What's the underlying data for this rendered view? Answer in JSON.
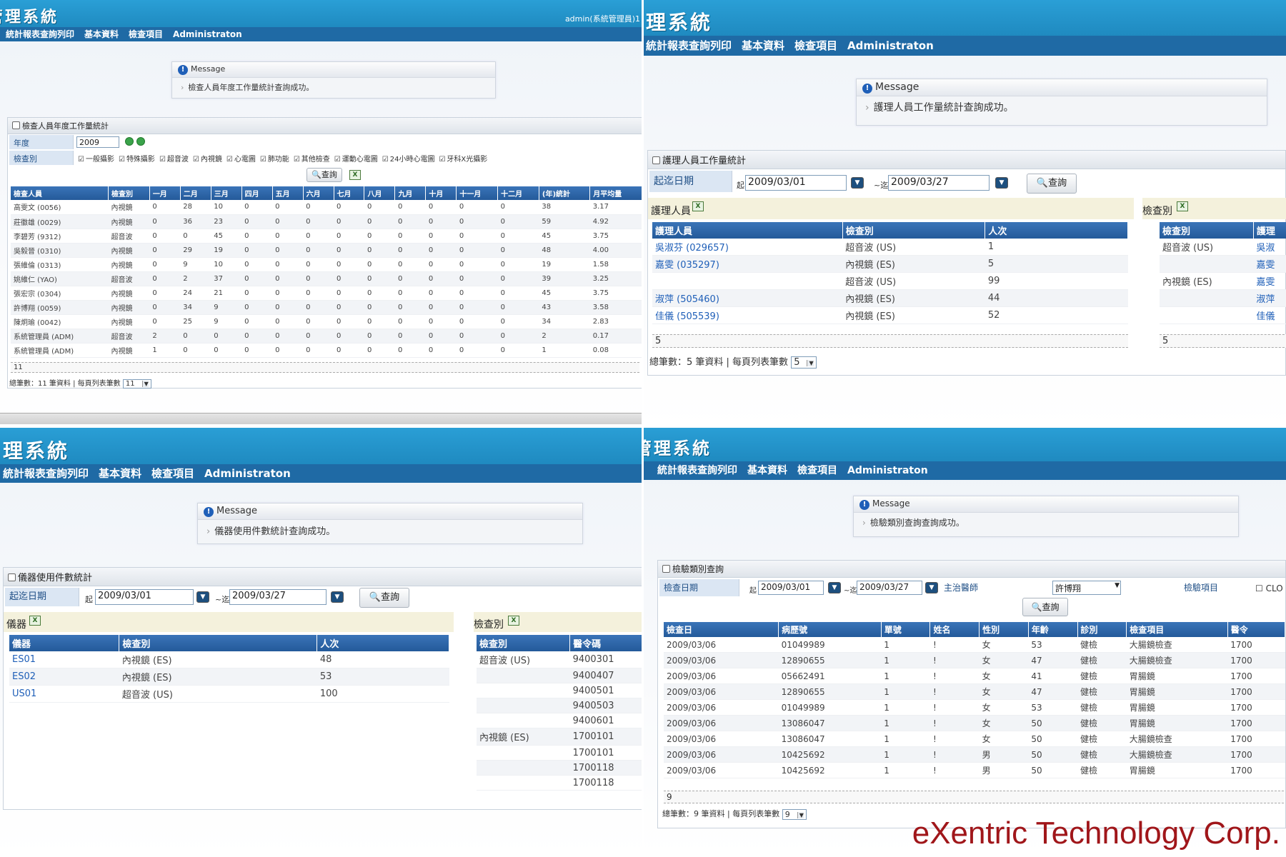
{
  "app": {
    "title_q1": "管理系統",
    "title_q2": "理系統",
    "title_q3": "理系統",
    "title_q4": "管理系統",
    "admin_label": "admin(系統管理員)1",
    "menu": [
      "統計報表查詢列印",
      "基本資料",
      "檢查項目",
      "Administraton"
    ]
  },
  "q1": {
    "message_title": "Message",
    "message_text": "檢查人員年度工作量統計查詢成功。",
    "panel_title": "檢查人員年度工作量統計",
    "year_label": "年度",
    "year_value": "2009",
    "type_label": "檢查別",
    "checkboxes": [
      "一般攝影",
      "特殊攝影",
      "超音波",
      "內視鏡",
      "心電圖",
      "肺功能",
      "其他檢查",
      "運動心電圖",
      "24小時心電圖",
      "牙科X光攝影"
    ],
    "query_label": "查詢",
    "columns": [
      "檢查人員",
      "檢查別",
      "一月",
      "二月",
      "三月",
      "四月",
      "五月",
      "六月",
      "七月",
      "八月",
      "九月",
      "十月",
      "十一月",
      "十二月",
      "(年)統計",
      "月平均量"
    ],
    "rows": [
      [
        "高雯文 (0056)",
        "內視鏡",
        "0",
        "28",
        "10",
        "0",
        "0",
        "0",
        "0",
        "0",
        "0",
        "0",
        "0",
        "0",
        "38",
        "3.17"
      ],
      [
        "莊徽雄 (0029)",
        "內視鏡",
        "0",
        "36",
        "23",
        "0",
        "0",
        "0",
        "0",
        "0",
        "0",
        "0",
        "0",
        "0",
        "59",
        "4.92"
      ],
      [
        "李碧芳 (9312)",
        "超音波",
        "0",
        "0",
        "45",
        "0",
        "0",
        "0",
        "0",
        "0",
        "0",
        "0",
        "0",
        "0",
        "45",
        "3.75"
      ],
      [
        "吳毅晉 (0310)",
        "內視鏡",
        "0",
        "29",
        "19",
        "0",
        "0",
        "0",
        "0",
        "0",
        "0",
        "0",
        "0",
        "0",
        "48",
        "4.00"
      ],
      [
        "張維倫 (0313)",
        "內視鏡",
        "0",
        "9",
        "10",
        "0",
        "0",
        "0",
        "0",
        "0",
        "0",
        "0",
        "0",
        "0",
        "19",
        "1.58"
      ],
      [
        "姚維仁 (YAO)",
        "超音波",
        "0",
        "2",
        "37",
        "0",
        "0",
        "0",
        "0",
        "0",
        "0",
        "0",
        "0",
        "0",
        "39",
        "3.25"
      ],
      [
        "張宏宗 (0304)",
        "內視鏡",
        "0",
        "24",
        "21",
        "0",
        "0",
        "0",
        "0",
        "0",
        "0",
        "0",
        "0",
        "0",
        "45",
        "3.75"
      ],
      [
        "許博翔 (0059)",
        "內視鏡",
        "0",
        "34",
        "9",
        "0",
        "0",
        "0",
        "0",
        "0",
        "0",
        "0",
        "0",
        "0",
        "43",
        "3.58"
      ],
      [
        "陳炯瑜 (0042)",
        "內視鏡",
        "0",
        "25",
        "9",
        "0",
        "0",
        "0",
        "0",
        "0",
        "0",
        "0",
        "0",
        "0",
        "34",
        "2.83"
      ],
      [
        "系統管理員 (ADM)",
        "超音波",
        "2",
        "0",
        "0",
        "0",
        "0",
        "0",
        "0",
        "0",
        "0",
        "0",
        "0",
        "0",
        "2",
        "0.17"
      ],
      [
        "系統管理員 (ADM)",
        "內視鏡",
        "1",
        "0",
        "0",
        "0",
        "0",
        "0",
        "0",
        "0",
        "0",
        "0",
        "0",
        "0",
        "1",
        "0.08"
      ]
    ],
    "count": "11",
    "footer_text": "總筆數：11 筆資料 | 每頁列表筆數",
    "page_size": "11"
  },
  "q2": {
    "message_title": "Message",
    "message_text": "護理人員工作量統計查詢成功。",
    "panel_title": "護理人員工作量統計",
    "date_label": "起迄日期",
    "from_prefix": "起",
    "to_prefix": "~迄",
    "from_date": "2009/03/01",
    "to_date": "2009/03/27",
    "query_label": "查詢",
    "left_title": "護理人員",
    "left_columns": [
      "護理人員",
      "檢查別",
      "人次"
    ],
    "left_rows": [
      [
        "吳淑芬 (029657)",
        "超音波 (US)",
        "1"
      ],
      [
        "嘉雯 (035297)",
        "內視鏡 (ES)",
        "5"
      ],
      [
        "",
        "超音波 (US)",
        "99"
      ],
      [
        "淑萍 (505460)",
        "內視鏡 (ES)",
        "44"
      ],
      [
        "佳儀 (505539)",
        "內視鏡 (ES)",
        "52"
      ]
    ],
    "left_count": "5",
    "right_title": "檢查別",
    "right_columns": [
      "檢查別",
      "護理"
    ],
    "right_rows": [
      [
        "超音波 (US)",
        "吳淑"
      ],
      [
        "",
        "嘉雯"
      ],
      [
        "內視鏡 (ES)",
        "嘉雯"
      ],
      [
        "",
        "淑萍"
      ],
      [
        "",
        "佳儀"
      ]
    ],
    "right_count": "5",
    "footer_text": "總筆數：5 筆資料 | 每頁列表筆數",
    "page_size": "5"
  },
  "q3": {
    "message_title": "Message",
    "message_text": "儀器使用件數統計查詢成功。",
    "panel_title": "儀器使用件數統計",
    "date_label": "起迄日期",
    "from_prefix": "起",
    "to_prefix": "~迄",
    "from_date": "2009/03/01",
    "to_date": "2009/03/27",
    "query_label": "查詢",
    "left_title": "儀器",
    "left_columns": [
      "儀器",
      "檢查別",
      "人次"
    ],
    "left_rows": [
      [
        "ES01",
        "內視鏡 (ES)",
        "48"
      ],
      [
        "ES02",
        "內視鏡 (ES)",
        "53"
      ],
      [
        "US01",
        "超音波 (US)",
        "100"
      ]
    ],
    "right_title": "檢查別",
    "right_columns": [
      "檢查別",
      "醫令碼"
    ],
    "right_rows": [
      [
        "超音波 (US)",
        "9400301"
      ],
      [
        "",
        "9400407"
      ],
      [
        "",
        "9400501"
      ],
      [
        "",
        "9400503"
      ],
      [
        "",
        "9400601"
      ],
      [
        "內視鏡 (ES)",
        "1700101"
      ],
      [
        "",
        "1700101"
      ],
      [
        "",
        "1700118"
      ],
      [
        "",
        "1700118"
      ]
    ]
  },
  "q4": {
    "message_title": "Message",
    "message_text": "檢驗類別查詢查詢成功。",
    "panel_title": "檢驗類別查詢",
    "date_label": "檢查日期",
    "from_prefix": "起",
    "to_prefix": "~迄",
    "from_date": "2009/03/01",
    "to_date": "2009/03/27",
    "doctor_label": "主治醫師",
    "doctor_value": "許博翔",
    "item_label": "檢驗項目",
    "item_option": "CLO",
    "query_label": "查詢",
    "columns": [
      "檢查日",
      "病歷號",
      "單號",
      "姓名",
      "性別",
      "年齡",
      "診別",
      "檢查項目",
      "醫令"
    ],
    "rows": [
      [
        "2009/03/06",
        "01049989",
        "1",
        "!",
        "女",
        "53",
        "健檢",
        "大腸鏡檢查",
        "1700"
      ],
      [
        "2009/03/06",
        "12890655",
        "1",
        "!",
        "女",
        "47",
        "健檢",
        "大腸鏡檢查",
        "1700"
      ],
      [
        "2009/03/06",
        "05662491",
        "1",
        "!",
        "女",
        "41",
        "健檢",
        "胃腸鏡",
        "1700"
      ],
      [
        "2009/03/06",
        "12890655",
        "1",
        "!",
        "女",
        "47",
        "健檢",
        "胃腸鏡",
        "1700"
      ],
      [
        "2009/03/06",
        "01049989",
        "1",
        "!",
        "女",
        "53",
        "健檢",
        "胃腸鏡",
        "1700"
      ],
      [
        "2009/03/06",
        "13086047",
        "1",
        "!",
        "女",
        "50",
        "健檢",
        "胃腸鏡",
        "1700"
      ],
      [
        "2009/03/06",
        "13086047",
        "1",
        "!",
        "女",
        "50",
        "健檢",
        "大腸鏡檢查",
        "1700"
      ],
      [
        "2009/03/06",
        "10425692",
        "1",
        "!",
        "男",
        "50",
        "健檢",
        "大腸鏡檢查",
        "1700"
      ],
      [
        "2009/03/06",
        "10425692",
        "1",
        "!",
        "男",
        "50",
        "健檢",
        "胃腸鏡",
        "1700"
      ]
    ],
    "count": "9",
    "footer_text": "總筆數：9 筆資料 | 每頁列表筆數",
    "page_size": "9"
  },
  "brand": "eXentric Technology Corp."
}
